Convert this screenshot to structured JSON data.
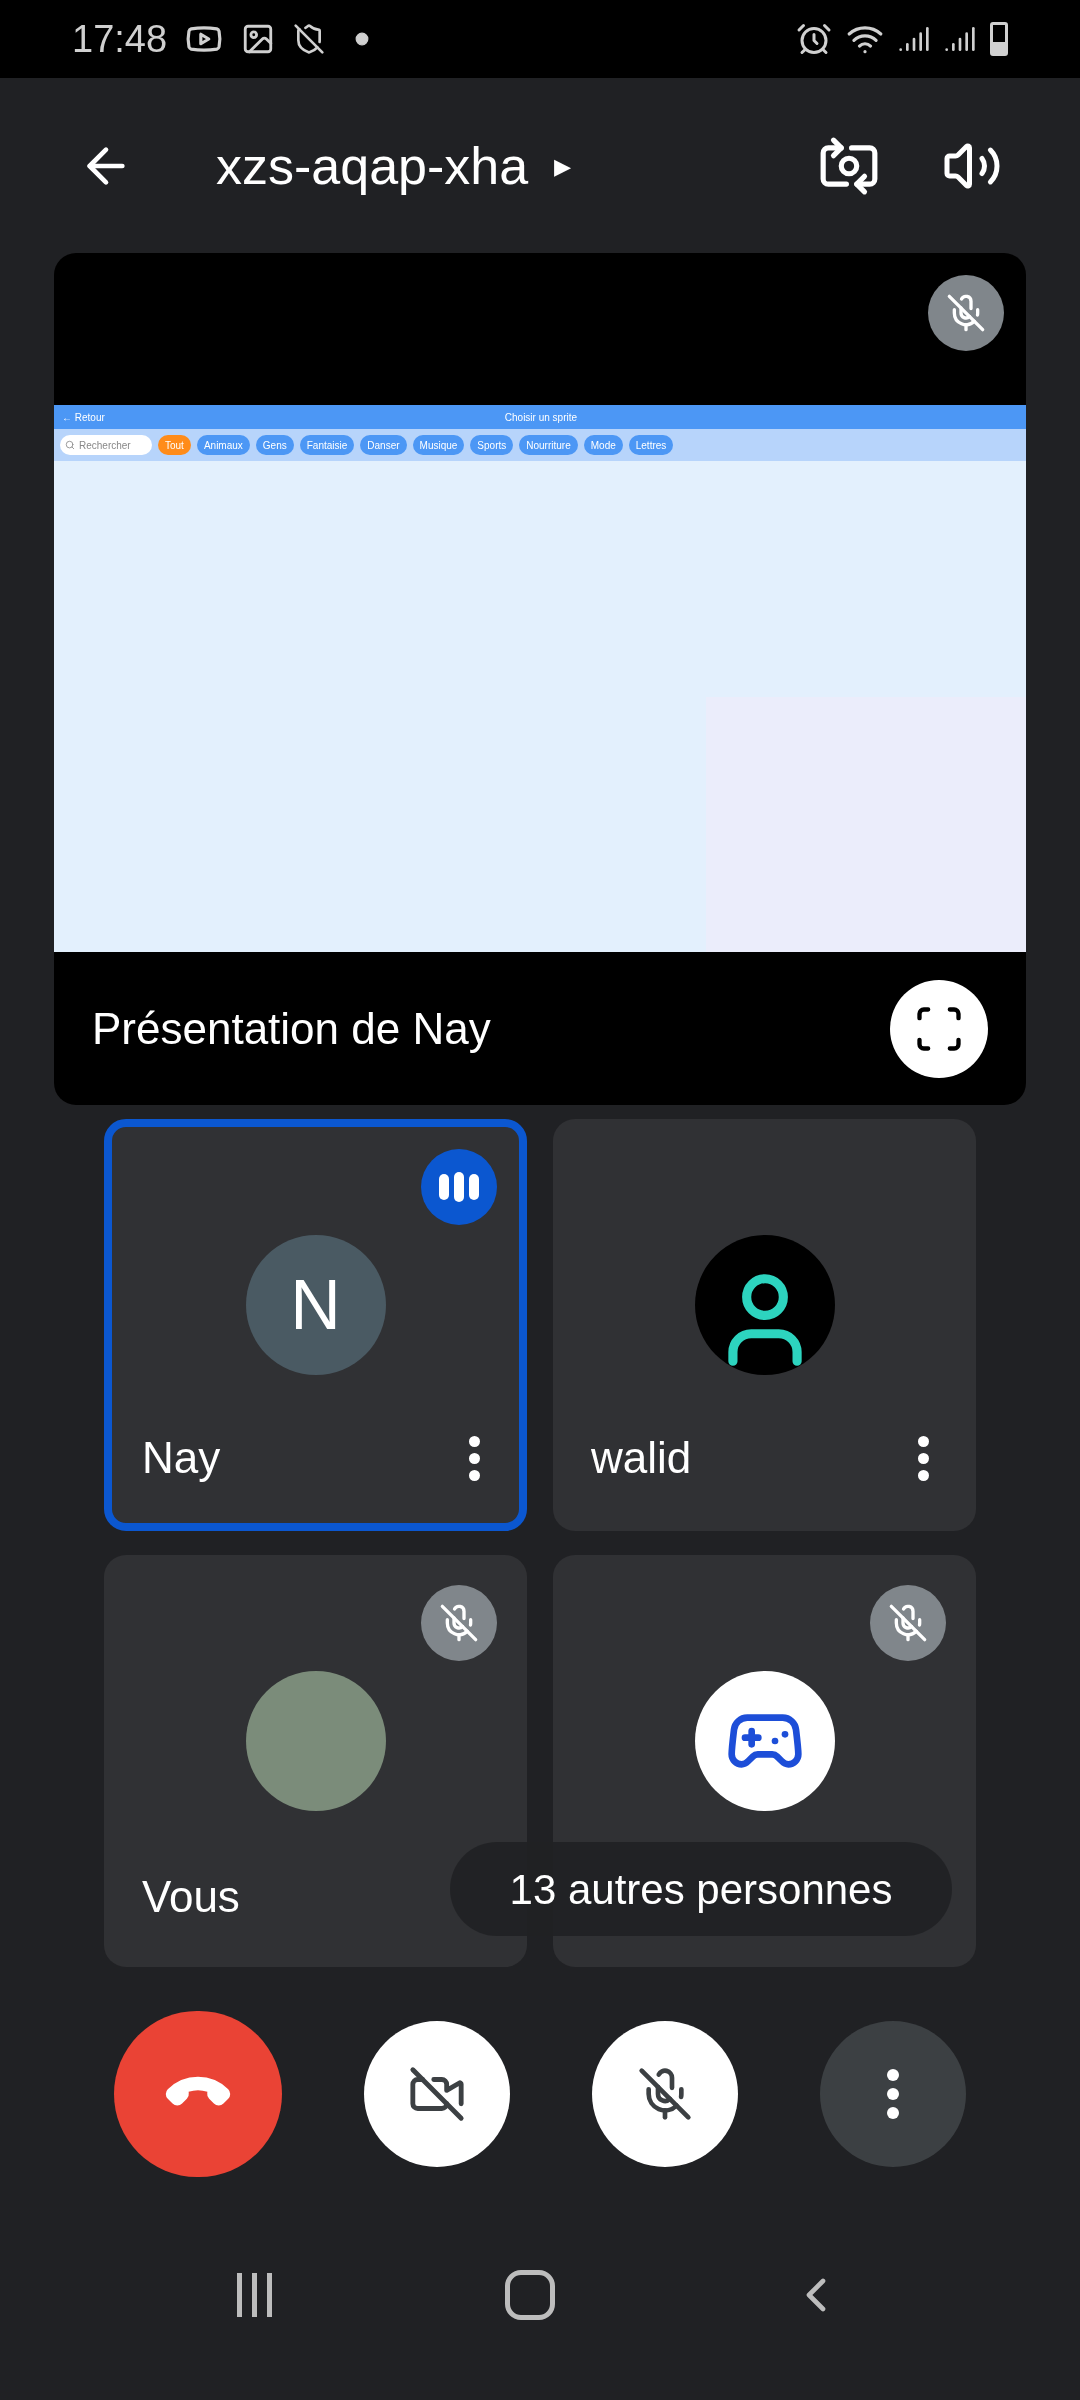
{
  "status_bar": {
    "time": "17:48"
  },
  "header": {
    "meeting_code": "xzs-aqap-xha",
    "caret": "▸"
  },
  "presentation": {
    "muted": true,
    "caption": "Présentation de Nay",
    "shared_screen": {
      "back": "← Retour",
      "title": "Choisir un sprite",
      "search_placeholder": "Rechercher",
      "chips": [
        {
          "label": "Tout",
          "selected": true
        },
        {
          "label": "Animaux",
          "selected": false
        },
        {
          "label": "Gens",
          "selected": false
        },
        {
          "label": "Fantaisie",
          "selected": false
        },
        {
          "label": "Danser",
          "selected": false
        },
        {
          "label": "Musique",
          "selected": false
        },
        {
          "label": "Sports",
          "selected": false
        },
        {
          "label": "Nourriture",
          "selected": false
        },
        {
          "label": "Mode",
          "selected": false
        },
        {
          "label": "Lettres",
          "selected": false
        }
      ]
    }
  },
  "tiles": [
    {
      "name": "Nay",
      "kind": "initial",
      "initial": "N",
      "speaking": true,
      "muted": false,
      "menu": true
    },
    {
      "name": "walid",
      "kind": "emoji",
      "speaking": false,
      "muted": false,
      "menu": true
    },
    {
      "name": "Vous",
      "kind": "photo",
      "speaking": false,
      "muted": true,
      "menu": false
    },
    {
      "kind": "logo",
      "speaking": false,
      "muted": true,
      "menu": false
    }
  ],
  "others_badge": "13 autres personnes",
  "controls": [
    {
      "kind": "hangup"
    },
    {
      "kind": "camera",
      "on": false
    },
    {
      "kind": "mic",
      "on": false
    },
    {
      "kind": "more"
    }
  ]
}
